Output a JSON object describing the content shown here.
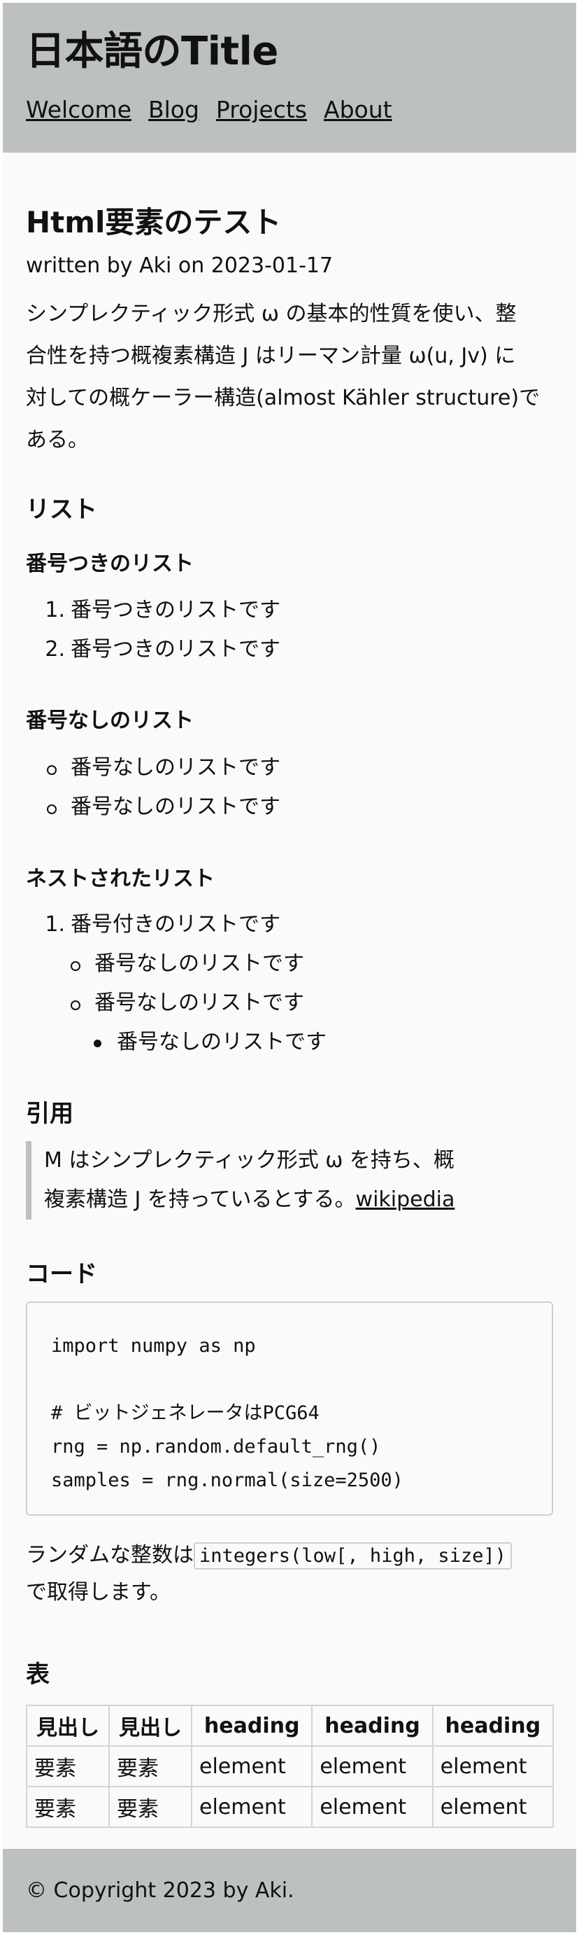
{
  "header": {
    "site_title": "日本語のTitle",
    "nav": [
      "Welcome",
      "Blog",
      "Projects",
      "About"
    ]
  },
  "article": {
    "title": "Html要素のテスト",
    "meta": "written by Aki on 2023-01-17",
    "intro_lines": [
      "シンプレクティック形式 ω の基本的性質を使い、整",
      "合性を持つ概複素構造 J はリーマン計量 ω(u, Jv) に",
      "対しての概ケーラー構造(almost Kähler structure)で",
      "ある。"
    ],
    "list_heading": "リスト",
    "ordered_heading": "番号つきのリスト",
    "ordered_items": [
      "番号つきのリストです",
      "番号つきのリストです"
    ],
    "unordered_heading": "番号なしのリスト",
    "unordered_items": [
      "番号なしのリストです",
      "番号なしのリストです"
    ],
    "nested_heading": "ネストされたリスト",
    "nested": {
      "item": "番号付きのリストです",
      "sub_items": [
        "番号なしのリストです",
        "番号なしのリストです"
      ],
      "sub_sub_item": "番号なしのリストです"
    },
    "quote_heading": "引用",
    "quote_lines": [
      "M はシンプレクティック形式 ω を持ち、概",
      "複素構造 J を持っているとする。"
    ],
    "quote_link": "wikipedia",
    "code_heading": "コード",
    "code": "import numpy as np\n\n# ビットジェネレータはPCG64\nrng = np.random.default_rng()\nsamples = rng.normal(size=2500)",
    "inline_code_before": "ランダムな整数は",
    "inline_code": "integers(low[, high, size])",
    "inline_code_after": "で取得します。",
    "table_heading": "表",
    "table": {
      "headers": [
        "見出し",
        "見出し",
        "heading",
        "heading",
        "heading"
      ],
      "rows": [
        [
          "要素",
          "要素",
          "element",
          "element",
          "element"
        ],
        [
          "要素",
          "要素",
          "element",
          "element",
          "element"
        ]
      ]
    }
  },
  "footer": {
    "copyright": "© Copyright 2023 by Aki."
  }
}
